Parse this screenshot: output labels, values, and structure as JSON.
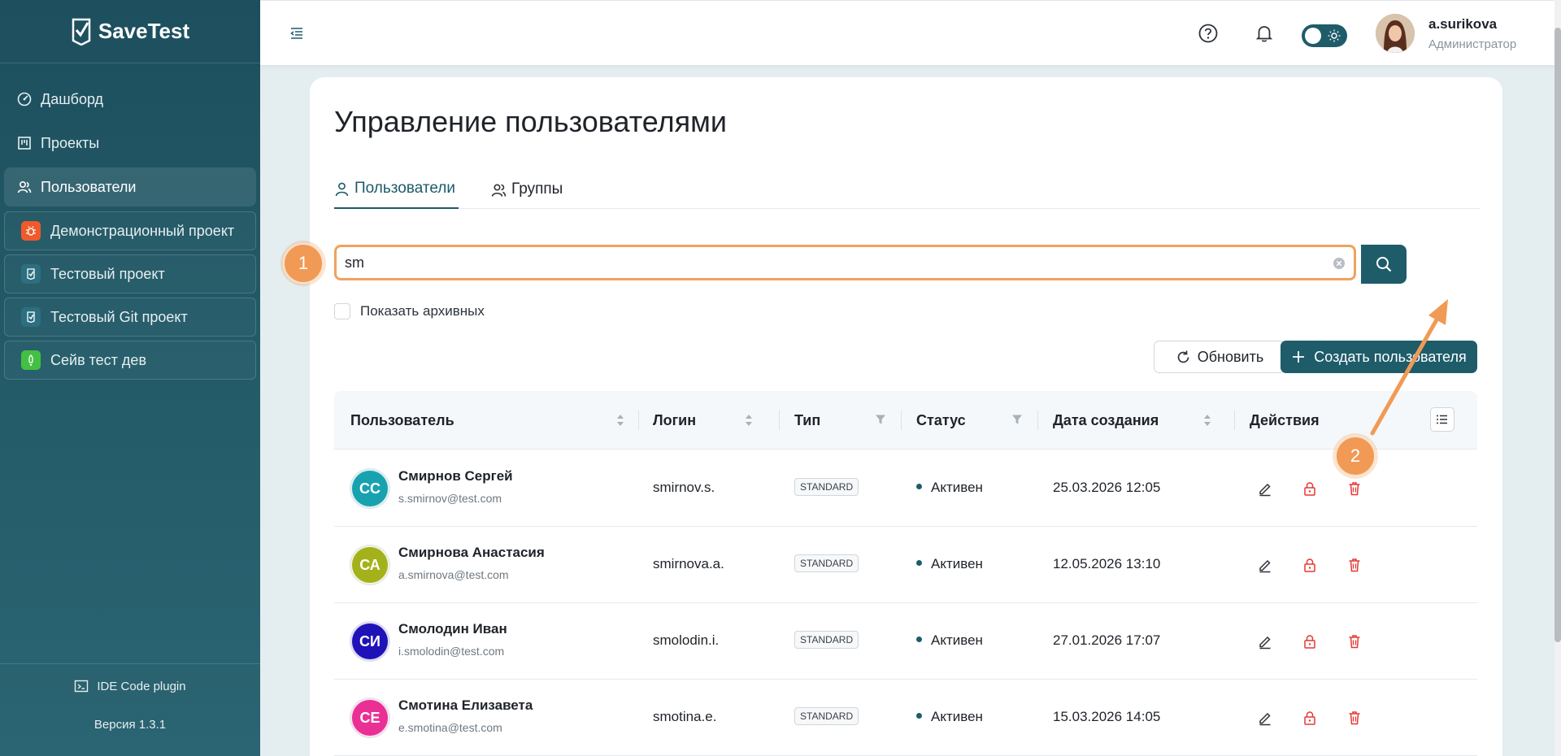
{
  "app": {
    "brand": "SaveTest"
  },
  "sidebar": {
    "nav": [
      {
        "label": "Дашборд",
        "icon": "dashboard-icon"
      },
      {
        "label": "Проекты",
        "icon": "projects-icon"
      },
      {
        "label": "Пользователи",
        "icon": "users-icon",
        "active": true
      }
    ],
    "projects": [
      {
        "label": "Демонстрационный проект",
        "color": "#f05a2a"
      },
      {
        "label": "Тестовый проект",
        "color": "#2b6f80"
      },
      {
        "label": "Тестовый Git проект",
        "color": "#2b6f80"
      },
      {
        "label": "Сейв тест дев",
        "color": "#43c043"
      }
    ],
    "plugin_label": "IDE Code plugin",
    "version": "Версия 1.3.1"
  },
  "header": {
    "user_name": "a.surikova",
    "user_role": "Администратор"
  },
  "page": {
    "title": "Управление пользователями",
    "tabs": [
      {
        "label": "Пользователи"
      },
      {
        "label": "Группы"
      }
    ],
    "search_value": "sm",
    "archive_label": "Показать архивных",
    "refresh_label": "Обновить",
    "create_label": "Создать пользователя"
  },
  "table": {
    "columns": [
      "Пользователь",
      "Логин",
      "Тип",
      "Статус",
      "Дата создания",
      "Действия"
    ],
    "rows": [
      {
        "initials": "СС",
        "avatar_color": "#18a2b0",
        "name": "Смирнов Сергей",
        "email": "s.smirnov@test.com",
        "login": "smirnov.s.",
        "type": "STANDARD",
        "status": "Активен",
        "created": "25.03.2026 12:05"
      },
      {
        "initials": "СА",
        "avatar_color": "#a3b21a",
        "name": "Смирнова Анастасия",
        "email": "a.smirnova@test.com",
        "login": "smirnova.a.",
        "type": "STANDARD",
        "status": "Активен",
        "created": "12.05.2026 13:10"
      },
      {
        "initials": "СИ",
        "avatar_color": "#1f12b8",
        "name": "Смолодин Иван",
        "email": "i.smolodin@test.com",
        "login": "smolodin.i.",
        "type": "STANDARD",
        "status": "Активен",
        "created": "27.01.2026 17:07"
      },
      {
        "initials": "СЕ",
        "avatar_color": "#ea2f95",
        "name": "Смотина Елизавета",
        "email": "e.smotina@test.com",
        "login": "smotina.e.",
        "type": "STANDARD",
        "status": "Активен",
        "created": "15.03.2026 14:05"
      }
    ]
  },
  "annotations": [
    "1",
    "2"
  ],
  "colors": {
    "accent": "#1e5c6a",
    "annotation": "#f19a55",
    "danger": "#e53935"
  }
}
